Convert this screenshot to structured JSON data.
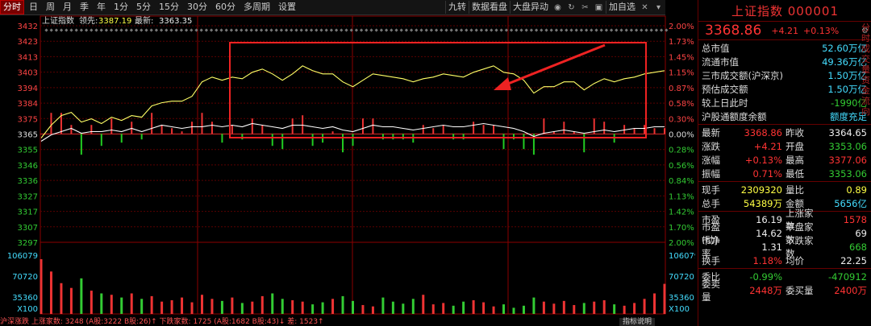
{
  "tabs": [
    "分时",
    "日",
    "周",
    "月",
    "季",
    "年",
    "1分",
    "5分",
    "15分",
    "30分",
    "60分",
    "多周期",
    "设置"
  ],
  "toolbar_right": [
    "九转",
    "数据看盘",
    "大盘异动",
    "加自选"
  ],
  "chart": {
    "header_index": "上证指数",
    "header_lead_label": "领先:",
    "header_lead_value": "3387.19",
    "header_latest_label": "最新:",
    "header_latest_value": "3363.35",
    "price_labels": [
      "3432",
      "3423",
      "3413",
      "3403",
      "3394",
      "3384",
      "3375",
      "3365",
      "3355",
      "3346",
      "3336",
      "3327",
      "3317",
      "3307",
      "3297"
    ],
    "pct_labels": [
      "2.00%",
      "1.73%",
      "1.45%",
      "1.15%",
      "0.87%",
      "0.58%",
      "0.30%",
      "0.00%",
      "0.28%",
      "0.56%",
      "0.84%",
      "1.13%",
      "1.42%",
      "1.70%",
      "2.00%"
    ],
    "vol_labels": [
      "106079",
      "70720",
      "35360",
      "X100"
    ],
    "status": "沪深涨跌 上涨家数: 3248 (A股:3222 B股:26)↑  下跌家数: 1725 (A股:1682 B股:43)↓  差: 1523↑",
    "indicator_btn": "指标说明"
  },
  "chart_data": {
    "type": "line",
    "title": "上证指数",
    "xlabel": "",
    "ylabel": "",
    "ylim": [
      3297,
      3432
    ],
    "prev_close": 3364.65,
    "series": [
      {
        "name": "上证指数",
        "values": [
          3362,
          3370,
          3376,
          3378,
          3372,
          3374,
          3371,
          3375,
          3373,
          3376,
          3375,
          3382,
          3384,
          3385,
          3385,
          3388,
          3397,
          3400,
          3398,
          3400,
          3399,
          3403,
          3405,
          3402,
          3398,
          3402,
          3407,
          3404,
          3402,
          3402,
          3397,
          3394,
          3398,
          3402,
          3401,
          3400,
          3399,
          3397,
          3399,
          3400,
          3402,
          3401,
          3400,
          3403,
          3405,
          3407,
          3403,
          3402,
          3398,
          3390,
          3394,
          3394,
          3397,
          3397,
          3392,
          3396,
          3399,
          3397,
          3399,
          3400,
          3402,
          3403,
          3404
        ]
      },
      {
        "name": "领先",
        "values": [
          3360,
          3364,
          3366,
          3368,
          3365,
          3366,
          3366,
          3367,
          3366,
          3368,
          3366,
          3368,
          3370,
          3369,
          3368,
          3369,
          3369,
          3370,
          3369,
          3370,
          3369,
          3371,
          3370,
          3369,
          3368,
          3370,
          3370,
          3369,
          3368,
          3369,
          3367,
          3366,
          3368,
          3370,
          3369,
          3369,
          3368,
          3367,
          3368,
          3369,
          3370,
          3369,
          3369,
          3370,
          3371,
          3370,
          3369,
          3368,
          3366,
          3363,
          3365,
          3366,
          3367,
          3366,
          3365,
          3366,
          3367,
          3366,
          3367,
          3368,
          3368,
          3369,
          3369
        ]
      }
    ],
    "volume": [
      80,
      62,
      45,
      38,
      52,
      34,
      30,
      28,
      24,
      30,
      22,
      26,
      18,
      20,
      24,
      17,
      28,
      22,
      19,
      24,
      16,
      18,
      26,
      30,
      22,
      20,
      18,
      14,
      17,
      22,
      26,
      19,
      13,
      11,
      24,
      18,
      15,
      22,
      28,
      14,
      16,
      12,
      18,
      20,
      17,
      11,
      14,
      9,
      12,
      24,
      18,
      15,
      19,
      13,
      16,
      18,
      20,
      14,
      12,
      16,
      22,
      30,
      44
    ]
  },
  "panel": {
    "title": "上证指数 000001",
    "price": "3368.86",
    "change": "+4.21",
    "change_pct": "+0.13%",
    "rows": [
      {
        "label": "总市值",
        "value": "52.60万亿"
      },
      {
        "label": "流通市值",
        "value": "49.36万亿"
      },
      {
        "label": "三市成交额(沪深京)",
        "value": "1.50万亿"
      },
      {
        "label": "预估成交额",
        "value": "1.50万亿"
      },
      {
        "label": "较上日此时",
        "value": "-1990亿"
      },
      {
        "label": "沪股通额度余额",
        "value": "额度充足"
      }
    ],
    "quote1": [
      {
        "l1": "最新",
        "v1": "3368.86",
        "l2": "昨收",
        "v2": "3364.65"
      },
      {
        "l1": "涨跌",
        "v1": "+4.21",
        "l2": "开盘",
        "v2": "3353.06"
      },
      {
        "l1": "涨幅",
        "v1": "+0.13%",
        "l2": "最高",
        "v2": "3377.06"
      },
      {
        "l1": "振幅",
        "v1": "0.71%",
        "l2": "最低",
        "v2": "3353.06"
      }
    ],
    "quote2": [
      {
        "l1": "现手",
        "v1": "2309320",
        "l2": "量比",
        "v2": "0.89"
      },
      {
        "l1": "总手",
        "v1": "54389万",
        "l2": "金额",
        "v2": "5656亿"
      }
    ],
    "quote3": [
      {
        "l1": "市盈",
        "v1": "16.19",
        "l2": "上涨家数",
        "v2": "1578"
      },
      {
        "l1": "市盈(动)",
        "v1": "14.62",
        "l2": "平盘家数",
        "v2": "69"
      },
      {
        "l1": "市净率",
        "v1": "1.31",
        "l2": "下跌家数",
        "v2": "668"
      },
      {
        "l1": "换手",
        "v1": "1.18%",
        "l2": "均价",
        "v2": "22.25"
      }
    ],
    "quote4": [
      {
        "l1": "委比",
        "v1": "-0.99%",
        "l2": "",
        "v2": "-470912"
      },
      {
        "l1": "委卖量",
        "v1": "2448万",
        "l2": "委买量",
        "v2": "2400万"
      }
    ],
    "side_strip": "分时成交量资金流向"
  }
}
